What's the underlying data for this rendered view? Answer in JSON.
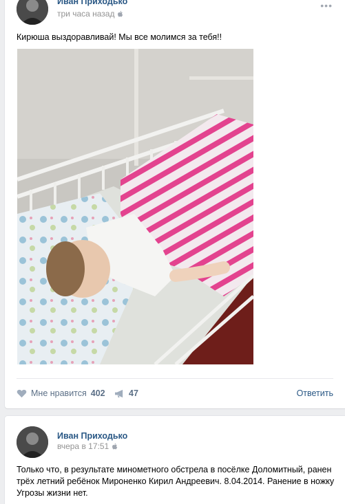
{
  "post1": {
    "author": "Иван Приходько",
    "time": "три часа назад",
    "text": "Кирюша выздоравливай! Мы все молимся за тебя!!",
    "likes_label": "Мне нравится",
    "likes_count": "402",
    "shares_count": "47",
    "reply_label": "Ответить"
  },
  "post2": {
    "author": "Иван Приходько",
    "time": "вчера в 17:51",
    "text_line1": "Только что, в результате минометного обстрела в посёлке Доломитный, ранен",
    "text_line2": "трёх летний ребёнок Мироненко Кирил Андреевич. 8.04.2014. Ранение в ножку",
    "text_line3": "Угрозы жизни нет."
  },
  "colors": {
    "link": "#2a5885",
    "muted": "#939393",
    "action": "#5b6f86",
    "background": "#edeef0"
  },
  "icons": [
    "more-icon",
    "apple-icon",
    "heart-icon",
    "megaphone-icon"
  ]
}
